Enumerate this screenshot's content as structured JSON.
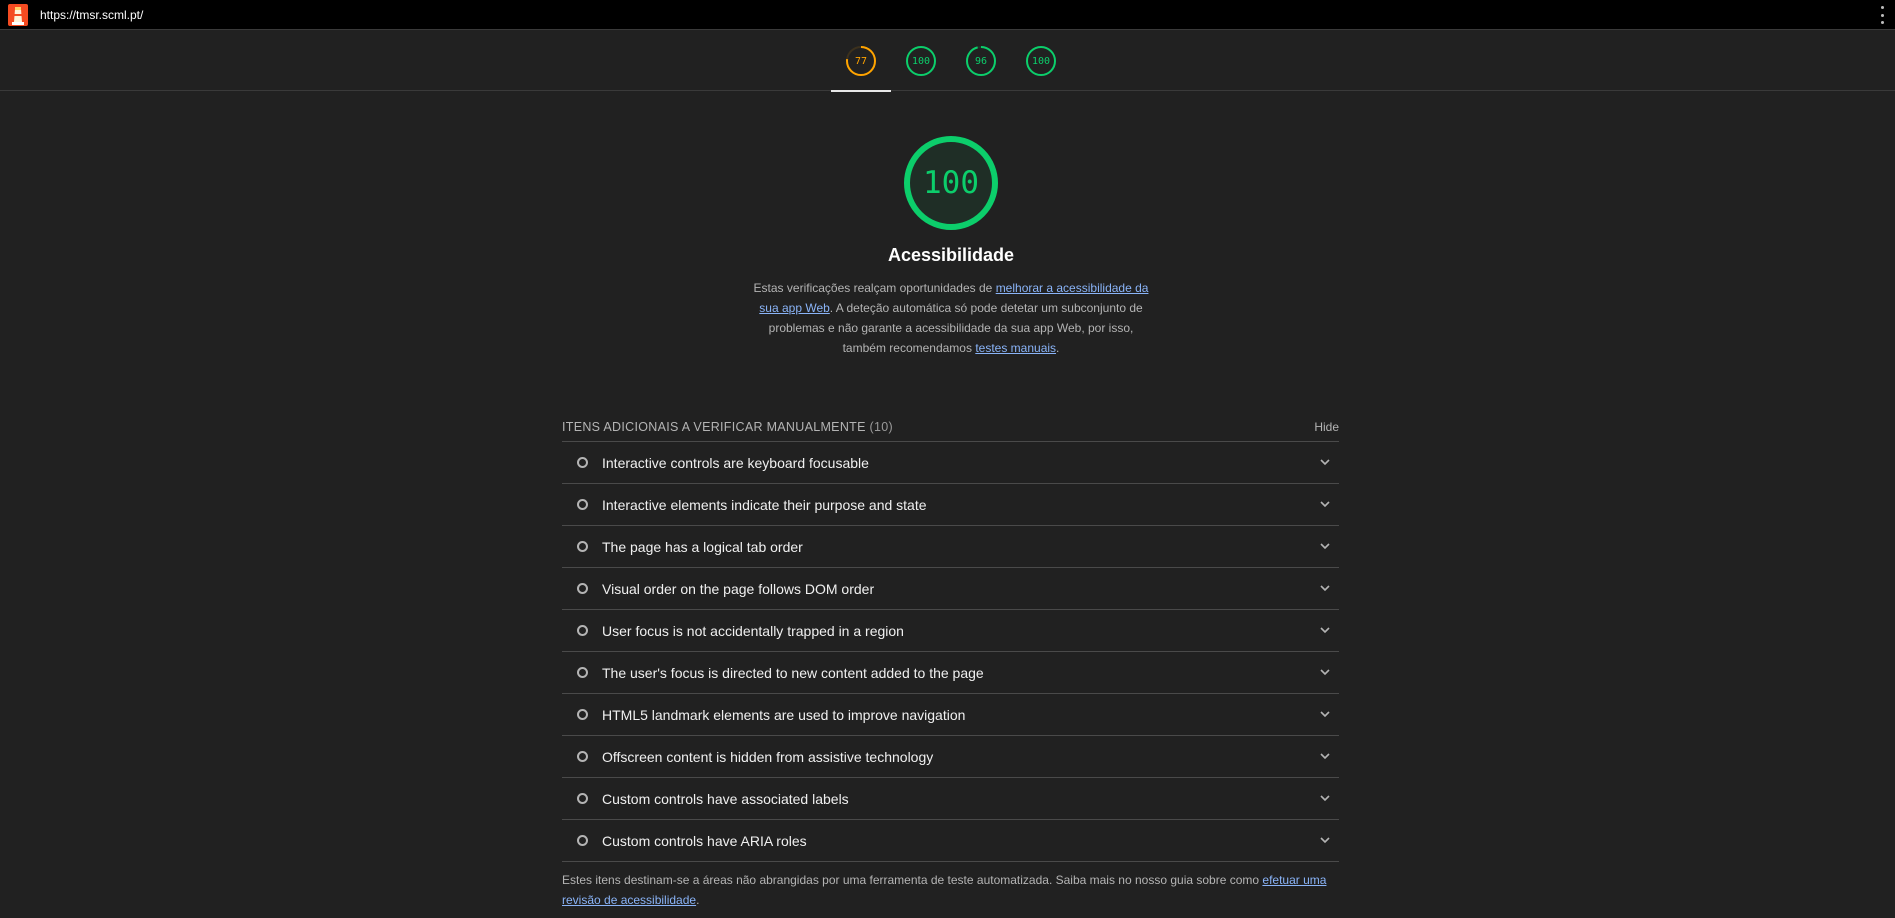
{
  "topbar": {
    "url": "https://tmsr.scml.pt/"
  },
  "tabs": [
    {
      "score": "77",
      "color": "#ffa400",
      "fraction": 0.77,
      "active": true
    },
    {
      "score": "100",
      "color": "#0cce6b",
      "fraction": 1.0,
      "active": false
    },
    {
      "score": "96",
      "color": "#0cce6b",
      "fraction": 0.96,
      "active": false
    },
    {
      "score": "100",
      "color": "#0cce6b",
      "fraction": 1.0,
      "active": false
    }
  ],
  "category": {
    "score": "100",
    "score_fraction": 1.0,
    "color": "#0cce6b",
    "title": "Acessibilidade",
    "desc_part1": "Estas verificações realçam oportunidades de ",
    "desc_link1": "melhorar a acessibilidade da sua app Web",
    "desc_part2": ". A deteção automática só pode detetar um subconjunto de problemas e não garante a acessibilidade da sua app Web, por isso, também recomendamos ",
    "desc_link2": "testes manuais",
    "desc_part3": "."
  },
  "group": {
    "title": "ITENS ADICIONAIS A VERIFICAR MANUALMENTE",
    "count": "(10)",
    "hide_label": "Hide",
    "audits": [
      "Interactive controls are keyboard focusable",
      "Interactive elements indicate their purpose and state",
      "The page has a logical tab order",
      "Visual order on the page follows DOM order",
      "User focus is not accidentally trapped in a region",
      "The user's focus is directed to new content added to the page",
      "HTML5 landmark elements are used to improve navigation",
      "Offscreen content is hidden from assistive technology",
      "Custom controls have associated labels",
      "Custom controls have ARIA roles"
    ],
    "footer_text": "Estes itens destinam-se a áreas não abrangidas por uma ferramenta de teste automatizada. Saiba mais no nosso guia sobre como ",
    "footer_link": "efetuar uma revisão de acessibilidade",
    "footer_end": "."
  },
  "icons": {
    "logo": "lighthouse-icon",
    "menu": "kebab-menu-icon",
    "audit_status": "manual-check-circle-icon",
    "expand": "chevron-down-icon"
  }
}
